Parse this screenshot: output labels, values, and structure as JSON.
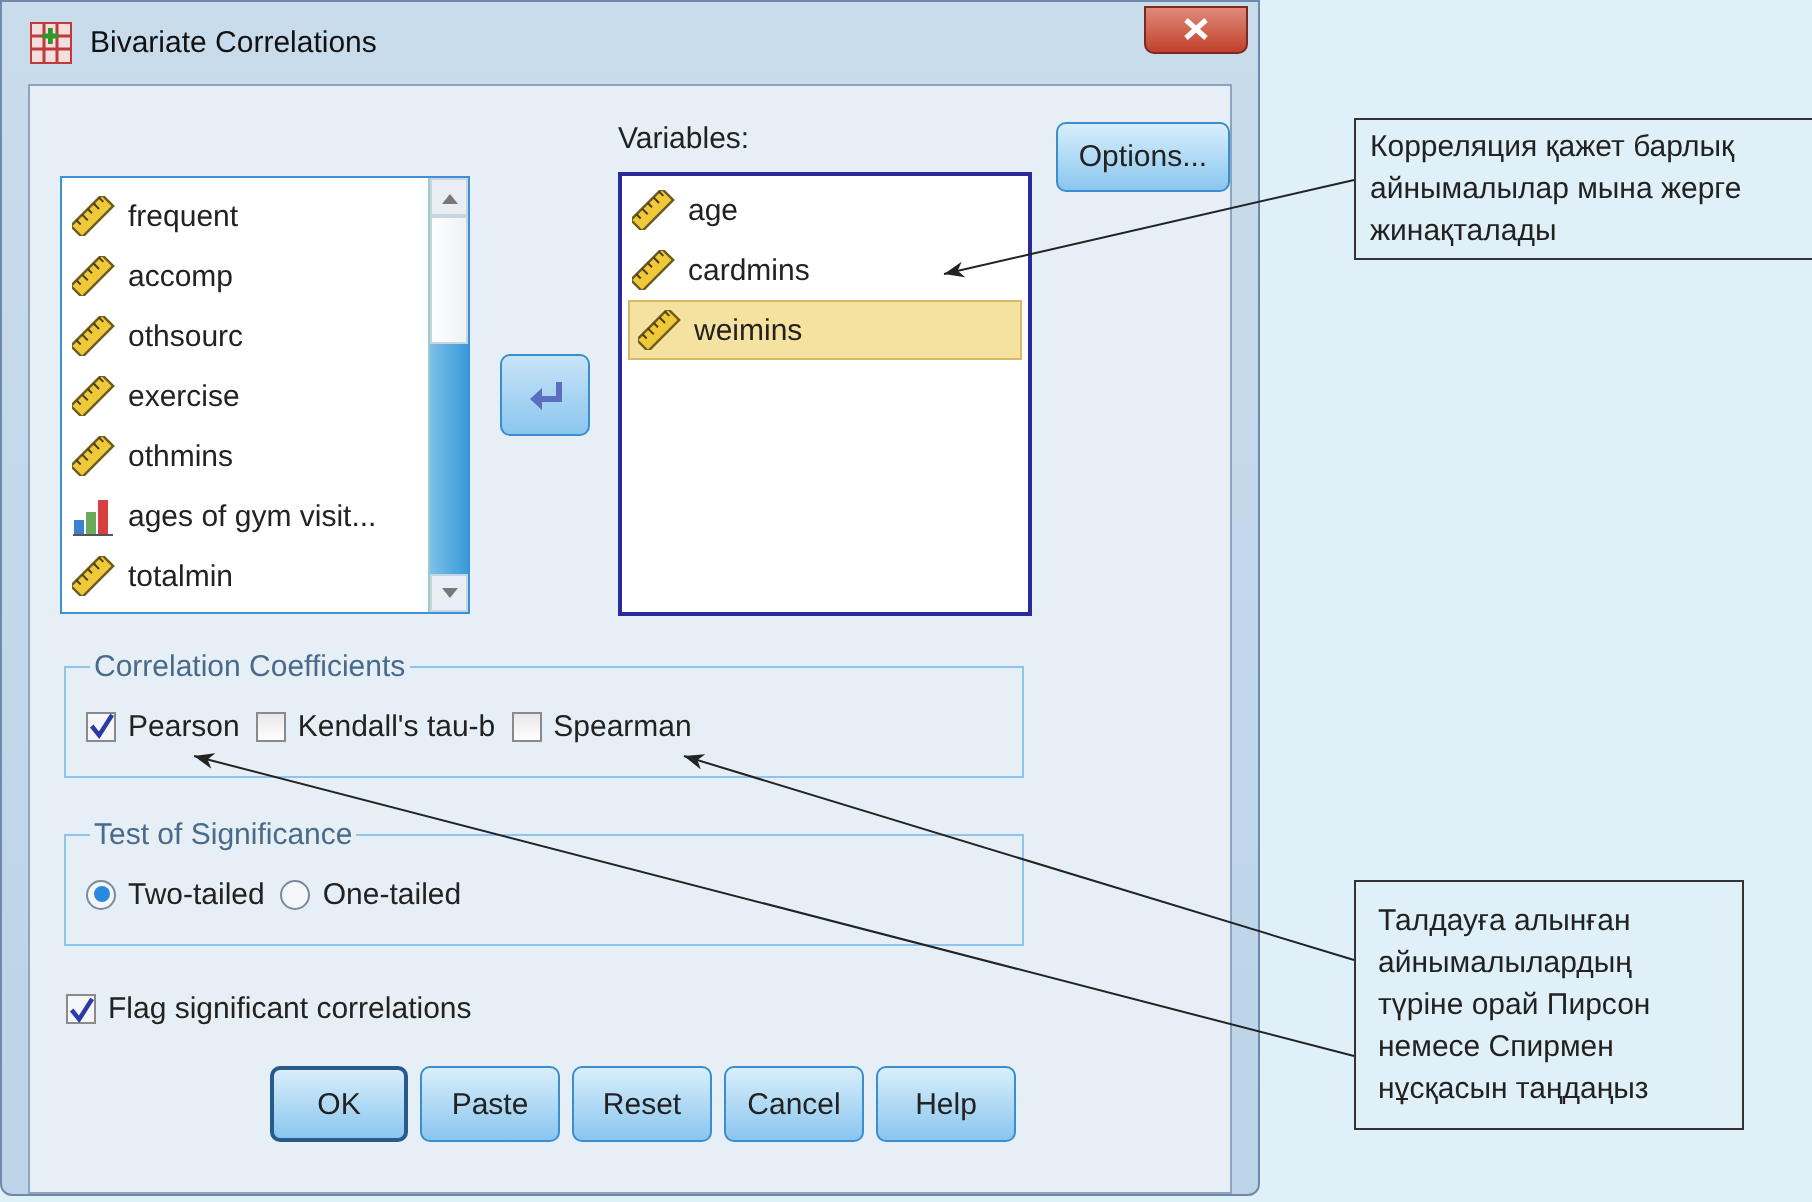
{
  "window": {
    "title": "Bivariate Correlations"
  },
  "source_list": {
    "items": [
      {
        "label": "frequent",
        "kind": "scale"
      },
      {
        "label": "accomp",
        "kind": "scale"
      },
      {
        "label": "othsourc",
        "kind": "scale"
      },
      {
        "label": "exercise",
        "kind": "scale"
      },
      {
        "label": "othmins",
        "kind": "scale"
      },
      {
        "label": "ages of gym visit...",
        "kind": "ordinal"
      },
      {
        "label": "totalmin",
        "kind": "scale"
      }
    ]
  },
  "variables": {
    "label": "Variables:",
    "items": [
      {
        "label": "age",
        "kind": "scale",
        "selected": false
      },
      {
        "label": "cardmins",
        "kind": "scale",
        "selected": false
      },
      {
        "label": "weimins",
        "kind": "scale",
        "selected": true
      }
    ]
  },
  "options_button": "Options...",
  "correlation_coefficients": {
    "title": "Correlation Coefficients",
    "options": [
      {
        "label": "Pearson",
        "checked": true
      },
      {
        "label": "Kendall's tau-b",
        "checked": false
      },
      {
        "label": "Spearman",
        "checked": false
      }
    ]
  },
  "test_of_significance": {
    "title": "Test of Significance",
    "options": [
      {
        "label": "Two-tailed",
        "selected": true
      },
      {
        "label": "One-tailed",
        "selected": false
      }
    ]
  },
  "flag_significant": {
    "label": "Flag significant correlations",
    "checked": true
  },
  "buttons": [
    {
      "label": "OK",
      "default": true
    },
    {
      "label": "Paste",
      "default": false
    },
    {
      "label": "Reset",
      "default": false
    },
    {
      "label": "Cancel",
      "default": false
    },
    {
      "label": "Help",
      "default": false
    }
  ],
  "callouts": [
    {
      "text": "Корреляция қажет барлық айнымалылар мына жерге жинақталады"
    },
    {
      "text": "Талдауға алынған айнымалылардың түріне орай Пирсон немесе Спирмен нұсқасын таңдаңыз"
    }
  ]
}
